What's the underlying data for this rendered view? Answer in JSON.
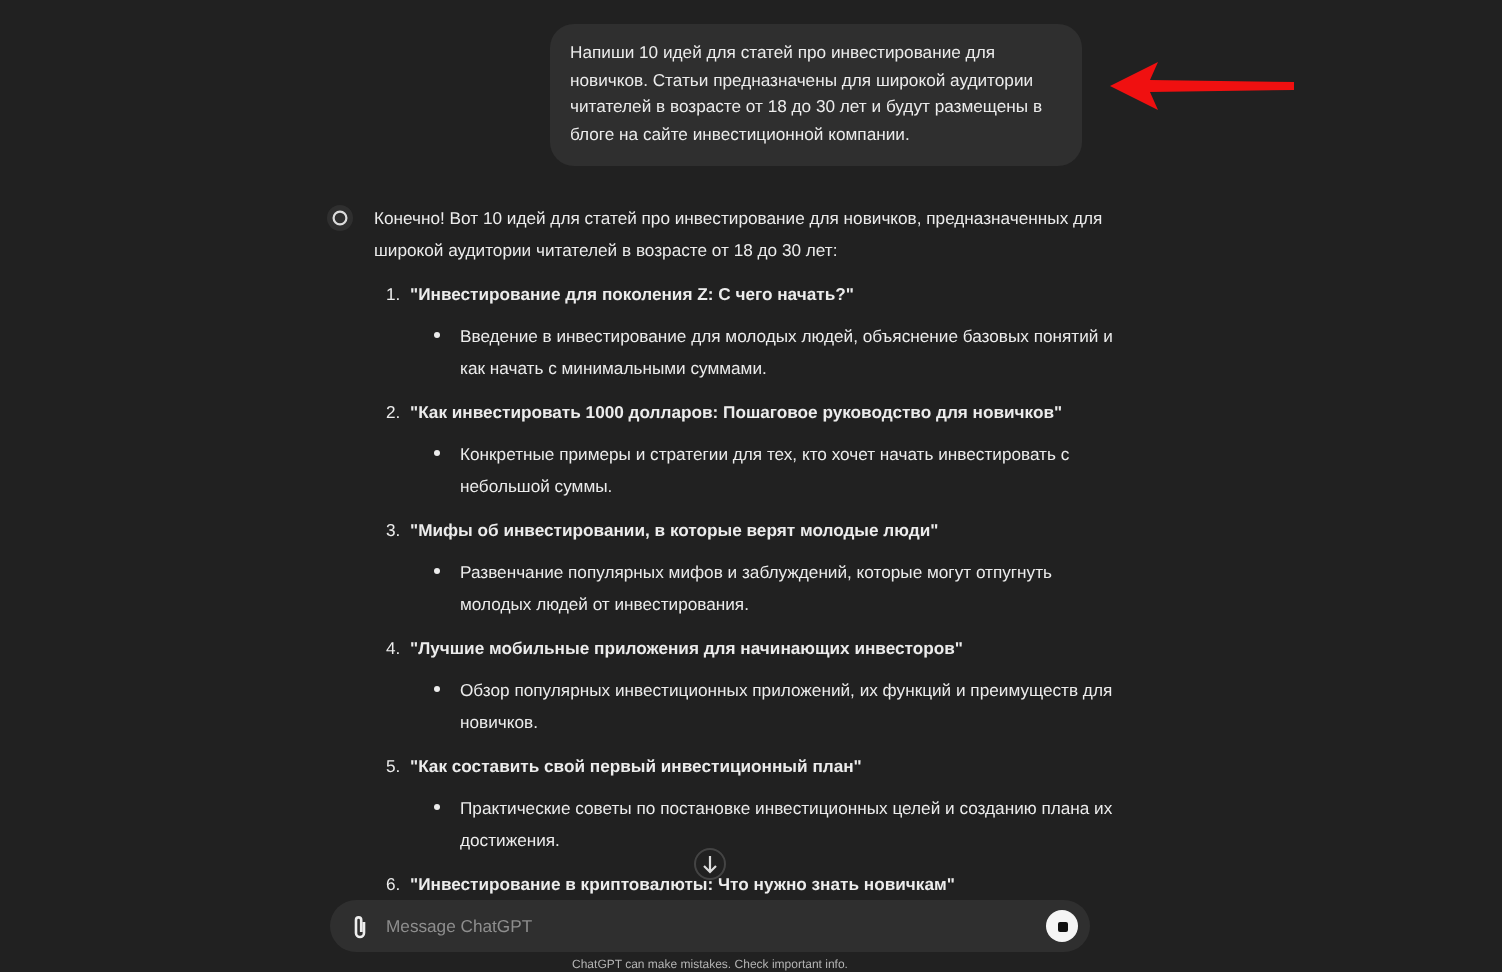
{
  "user_message": "Напиши 10 идей для статей про инвестирование для новичков. Статьи предназначены для широкой аудитории читателей в возрасте от 18 до 30 лет и будут размещены в блоге на сайте инвестиционной компании.",
  "reply": {
    "intro": "Конечно! Вот 10 идей для статей про инвестирование для новичков, предназначенных для широкой аудитории читателей в возрасте от 18 до 30 лет:",
    "items": [
      {
        "number": "1.",
        "title": "\"Инвестирование для поколения Z: С чего начать?\"",
        "bullet": "Введение в инвестирование для молодых людей, объяснение базовых понятий и как начать с минимальными суммами."
      },
      {
        "number": "2.",
        "title": "\"Как инвестировать 1000 долларов: Пошаговое руководство для новичков\"",
        "bullet": "Конкретные примеры и стратегии для тех, кто хочет начать инвестировать с небольшой суммы."
      },
      {
        "number": "3.",
        "title": "\"Мифы об инвестировании, в которые верят молодые люди\"",
        "bullet": "Развенчание популярных мифов и заблуждений, которые могут отпугнуть молодых людей от инвестирования."
      },
      {
        "number": "4.",
        "title": "\"Лучшие мобильные приложения для начинающих инвесторов\"",
        "bullet": "Обзор популярных инвестиционных приложений, их функций и преимуществ для новичков."
      },
      {
        "number": "5.",
        "title": "\"Как составить свой первый инвестиционный план\"",
        "bullet": "Практические советы по постановке инвестиционных целей и созданию плана их достижения."
      },
      {
        "number": "6.",
        "title": "\"Инвестирование в криптовалюты: Что нужно знать новичкам\""
      }
    ]
  },
  "composer": {
    "placeholder": "Message ChatGPT"
  },
  "footer": "ChatGPT can make mistakes. Check important info."
}
